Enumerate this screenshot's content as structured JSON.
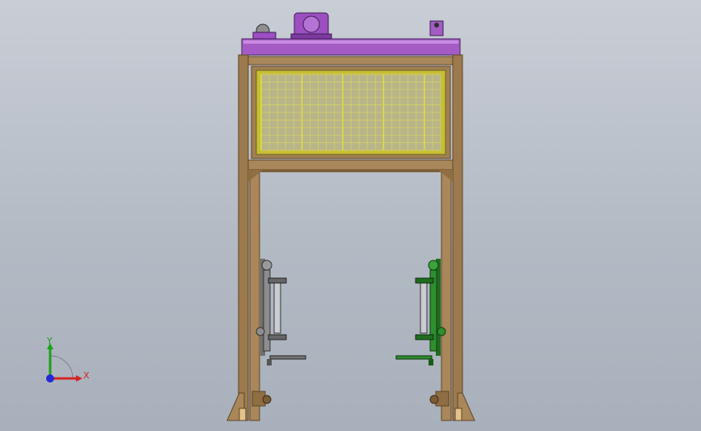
{
  "triad": {
    "x_label": "X",
    "y_label": "Y"
  },
  "colors": {
    "background": "#b7bdc6",
    "frame_wood": "#9c7a4e",
    "frame_wood_dark": "#5e4527",
    "top_beam": "#a45cc4",
    "motor": "#9b4fc0",
    "mesh_frame": "#c7be36",
    "mesh_fill": "#b8b58a",
    "left_gripper": "#8d8d8d",
    "right_gripper": "#2e8f2e",
    "axis_x": "#d42424",
    "axis_y": "#1aa11a",
    "axis_z": "#2727d8"
  }
}
